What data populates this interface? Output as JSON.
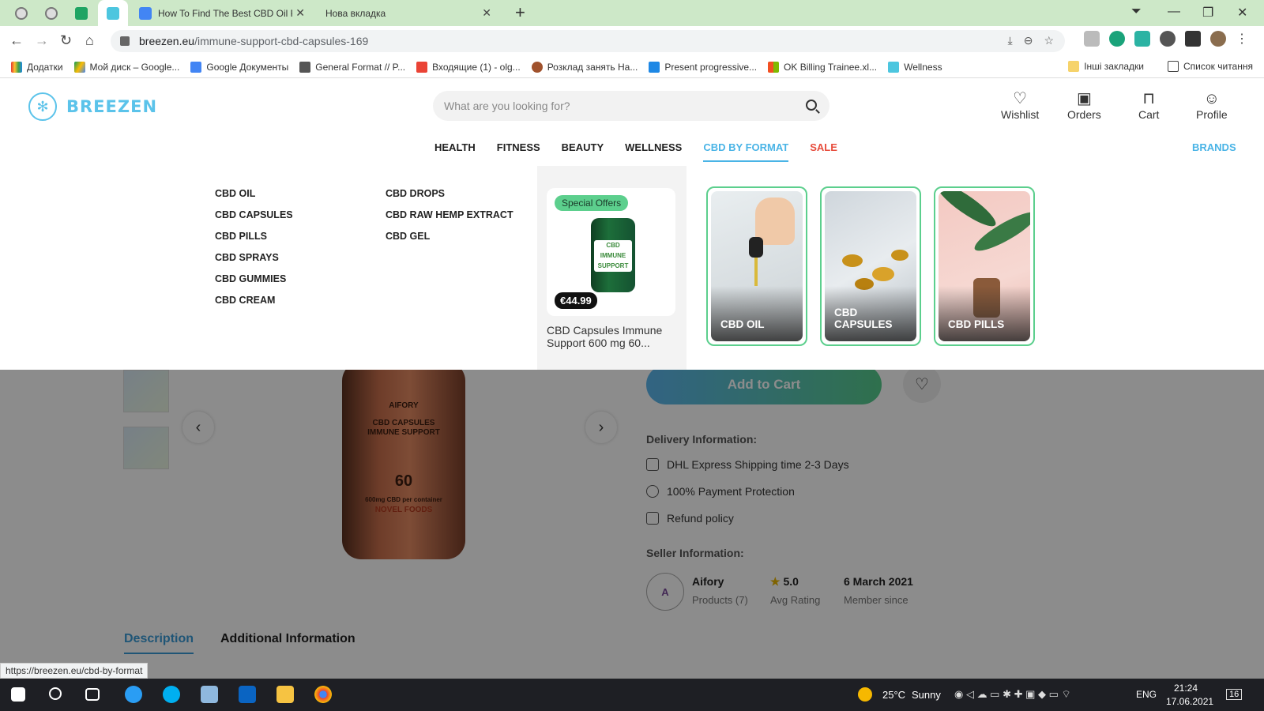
{
  "browser": {
    "tabs": [
      {
        "title": "How To Find The Best CBD Oil Pr"
      },
      {
        "title": "Нова вкладка"
      }
    ],
    "new_tab_label": "+",
    "url_host": "breezen.eu",
    "url_path": "/immune-support-cbd-capsules-169",
    "bookmarks": [
      {
        "label": "Додатки"
      },
      {
        "label": "Мой диск – Google..."
      },
      {
        "label": "Google Документы"
      },
      {
        "label": "General Format // P..."
      },
      {
        "label": "Входящие (1) - olg..."
      },
      {
        "label": "Розклад занять На..."
      },
      {
        "label": "Present progressive..."
      },
      {
        "label": "OK Billing Trainee.xl..."
      },
      {
        "label": "Wellness"
      }
    ],
    "bookmarks_other": "Інші закладки",
    "reading_list": "Список читання",
    "status_url": "https://breezen.eu/cbd-by-format"
  },
  "site": {
    "logo_text": "BREEZEN",
    "search_placeholder": "What are you looking for?",
    "actions": {
      "wishlist": "Wishlist",
      "orders": "Orders",
      "cart": "Cart",
      "profile": "Profile"
    },
    "nav": {
      "health": "HEALTH",
      "fitness": "FITNESS",
      "beauty": "BEAUTY",
      "wellness": "WELLNESS",
      "cbd_by_format": "CBD BY FORMAT",
      "sale": "SALE",
      "brands": "BRANDS"
    },
    "mega_menu": {
      "col1": [
        "CBD OIL",
        "CBD CAPSULES",
        "CBD PILLS",
        "CBD SPRAYS",
        "CBD GUMMIES",
        "CBD CREAM"
      ],
      "col2": [
        "CBD DROPS",
        "CBD RAW HEMP EXTRACT",
        "CBD GEL"
      ],
      "special": {
        "badge": "Special Offers",
        "price": "€44.99",
        "name": "CBD Capsules Immune Support 600 mg 60...",
        "jar_label": "CBD IMMUNE SUPPORT"
      },
      "format_cards": [
        {
          "label": "CBD OIL"
        },
        {
          "label": "CBD CAPSULES"
        },
        {
          "label": "CBD PILLS"
        }
      ]
    },
    "product": {
      "bottle_brand": "AIFORY",
      "bottle_line1": "CBD CAPSULES",
      "bottle_line2": "IMMUNE SUPPORT",
      "bottle_count": "60",
      "bottle_line3": "600mg CBD per container",
      "bottle_line4": "NOVEL FOODS",
      "add_to_cart": "Add to Cart",
      "delivery_title": "Delivery Information:",
      "delivery": [
        "DHL Express Shipping time 2-3 Days",
        "100% Payment Protection",
        "Refund policy"
      ],
      "seller_title": "Seller Information:",
      "seller": {
        "name": "Aifory",
        "products": "Products (7)",
        "rating": "5.0",
        "rating_label": "Avg Rating",
        "member_date": "6 March 2021",
        "member_label": "Member since"
      },
      "tab_description": "Description",
      "tab_additional": "Additional Information"
    }
  },
  "taskbar": {
    "weather_temp": "25°C",
    "weather_text": "Sunny",
    "lang": "ENG",
    "time": "21:24",
    "date": "17.06.2021",
    "notif_count": "16"
  }
}
